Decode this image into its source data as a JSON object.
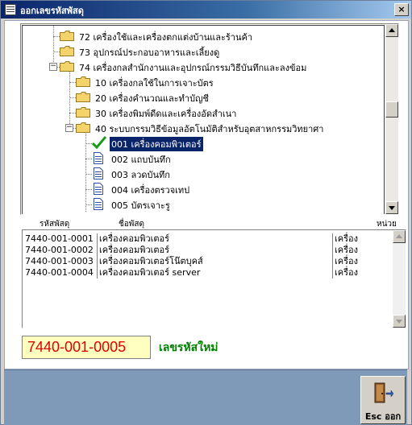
{
  "window": {
    "title": "ออกเลขรหัสพัสดุ",
    "close": "×"
  },
  "tree": {
    "nodes": [
      {
        "label": "72 เครื่องใช้และเครื่องตกแต่งบ้านและร้านค้า",
        "type": "folder"
      },
      {
        "label": "73 อุปกรณ์ประกอบอาหารและเลี้ยงดู",
        "type": "folder"
      },
      {
        "label": "74 เครื่องกลสำนักงานและอุปกรณ์กรรมวิธีบันทึกและลงข้อม",
        "type": "folder",
        "expander": "−"
      },
      {
        "label": "10 เครื่องกลใช้ในการเจาะบัตร",
        "type": "folder"
      },
      {
        "label": "20 เครื่องคำนวณและทำบัญชี",
        "type": "folder"
      },
      {
        "label": "30 เครื่องพิมพ์ดีดและเครื่องอัดสำเนา",
        "type": "folder"
      },
      {
        "label": "40 ระบบกรรมวิธีข้อมูลอัตโนมัติสำหรับอุตสาหกรรมวิทยาศา",
        "type": "folder",
        "expander": "−"
      },
      {
        "label": "001 เครื่องคอมพิวเตอร์",
        "type": "check",
        "selected": true
      },
      {
        "label": "002 แถบบันทึก",
        "type": "doc"
      },
      {
        "label": "003 ลวดบันทึก",
        "type": "doc"
      },
      {
        "label": "004 เครื่องตรวจเทป",
        "type": "doc"
      },
      {
        "label": "005 บัตรเจาะรู",
        "type": "doc"
      }
    ]
  },
  "list": {
    "headers": {
      "code": "รหัสพัสดุ",
      "name": "ชื่อพัสดุ",
      "unit": "หน่วย"
    },
    "rows": [
      {
        "code": "7440-001-0001",
        "name": "เครื่องคอมพิวเตอร์",
        "unit": "เครื่อง"
      },
      {
        "code": "7440-001-0002",
        "name": "เครื่องคอมพิวเตอร์",
        "unit": "เครื่อง"
      },
      {
        "code": "7440-001-0003",
        "name": "เครื่องคอมพิวเตอร์โน๊ตบุคส์",
        "unit": "เครื่อง"
      },
      {
        "code": "7440-001-0004",
        "name": "เครื่องคอมพิวเตอร์ server",
        "unit": "เครื่อง"
      }
    ]
  },
  "new_code": {
    "value": "7440-001-0005",
    "label": "เลขรหัสใหม่"
  },
  "esc_button": {
    "label": "Esc ออก"
  }
}
